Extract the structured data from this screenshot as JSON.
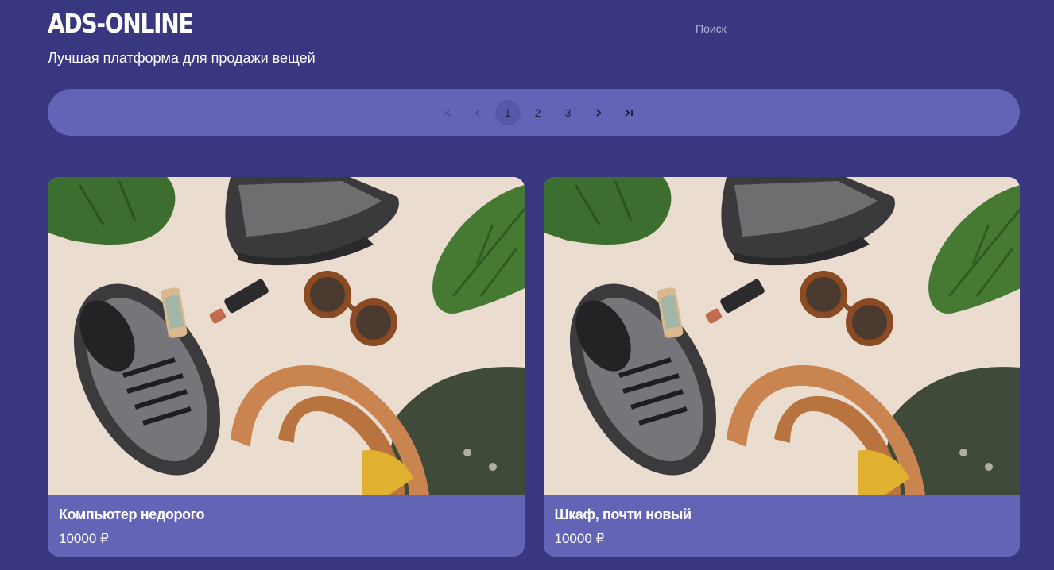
{
  "header": {
    "logo": "ADS-ONLINE",
    "tagline": "Лучшая платформа для продажи вещей"
  },
  "search": {
    "placeholder": "Поиск",
    "value": ""
  },
  "pagination": {
    "pages": [
      "1",
      "2",
      "3"
    ],
    "current_page": 1,
    "first_icon": "first-page-icon",
    "prev_icon": "chevron-left-icon",
    "next_icon": "chevron-right-icon",
    "last_icon": "last-page-icon"
  },
  "ads": [
    {
      "title": "Компьютер недорого",
      "price": "10000 ₽"
    },
    {
      "title": "Шкаф, почти новый",
      "price": "10000 ₽"
    }
  ],
  "colors": {
    "background": "#383780",
    "accent": "#6464b7",
    "active_page": "#5757a8"
  }
}
